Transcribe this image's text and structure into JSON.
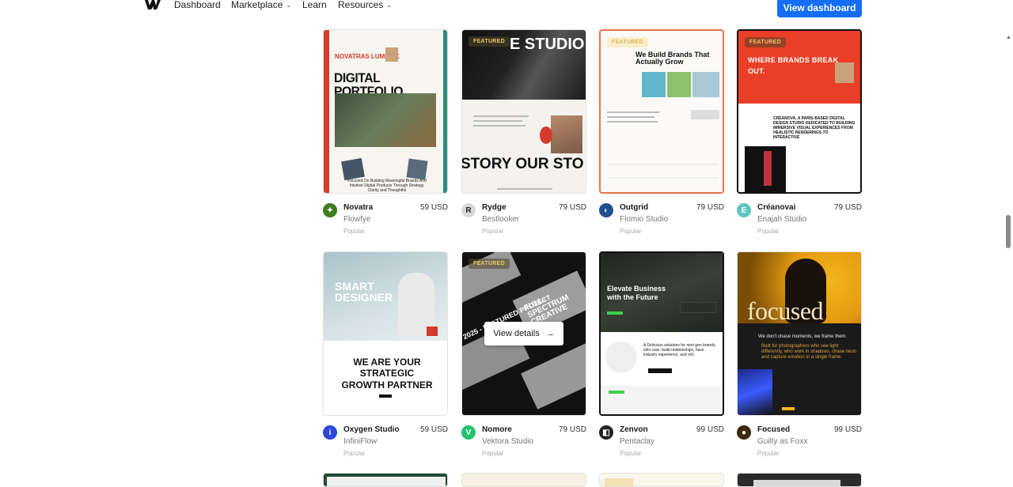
{
  "nav": {
    "items": [
      {
        "label": "Dashboard",
        "has_menu": false
      },
      {
        "label": "Marketplace",
        "has_menu": true
      },
      {
        "label": "Learn",
        "has_menu": false
      },
      {
        "label": "Resources",
        "has_menu": true
      }
    ],
    "cta": "View dashboard"
  },
  "cards": [
    {
      "title": "Novatra",
      "seller": "Flowfye",
      "price": "59 USD",
      "tag": "Popular",
      "featured": "",
      "avatar_color": "#3a7d1e",
      "thumb_text": "DIGITAL PORTFOLIO",
      "thumb_sub": "NOVATRAS LUMIVEX",
      "thumb_caption": "Focused On Building Meaningful Brands And Intuitive Digital Products Through Strategy, Clarity and Thoughtful"
    },
    {
      "title": "Rydge",
      "seller": "Bestlooker",
      "price": "79 USD",
      "tag": "Popular",
      "featured": "FEATURED",
      "avatar_color": "#d9d9d9",
      "thumb_text": "E STUDIO",
      "thumb_sub": "STORY  OUR STO"
    },
    {
      "title": "Outgrid",
      "seller": "Flomio Studio",
      "price": "79 USD",
      "tag": "Popular",
      "featured": "FEATURED",
      "avatar_color": "#1f4f8f",
      "thumb_text": "We Build Brands That Actually Grow"
    },
    {
      "title": "Créanovai",
      "seller": "Enajah Studio",
      "price": "79 USD",
      "tag": "Popular",
      "featured": "FEATURED",
      "avatar_color": "#5ec6c0",
      "thumb_text": "WHERE BRANDS BREAK OUT.",
      "thumb_sub": "CRÉANOVA, A PARIS-BASED DIGITAL DESIGN STUDIO DEDICATED TO BUILDING IMMERSIVE VISUAL EXPERIENCES FROM HEALISTIC RENDERINGS TO INTERACTIVE"
    },
    {
      "title": "Oxygen Studio",
      "seller": "InfiniFlow",
      "price": "59 USD",
      "tag": "Popular",
      "featured": "",
      "avatar_color": "#2e46d6",
      "thumb_text": "SMART DESIGNER",
      "thumb_sub": "WE ARE YOUR STRATEGIC GROWTH PARTNER"
    },
    {
      "title": "Nomore",
      "seller": "Vektora Studio",
      "price": "79 USD",
      "tag": "Popular",
      "featured": "FEATURED",
      "avatar_color": "#25c270",
      "thumb_text": "FULL-SPECTRUM CREATIVE",
      "thumb_sub": "2025 - FEATURED PROJECT",
      "hover_button": "View details"
    },
    {
      "title": "Zenvon",
      "seller": "Pentaclay",
      "price": "99 USD",
      "tag": "Popular",
      "featured": "",
      "avatar_color": "#222222",
      "thumb_text": "Elevate Business with the Future",
      "thumb_sub": "A Delicious solutions for next gen brands, who care, build relationships, have industry experience, and rich"
    },
    {
      "title": "Focused",
      "seller": "Guilty as Foxx",
      "price": "99 USD",
      "tag": "Popular",
      "featured": "",
      "avatar_color": "#3a2a10",
      "thumb_text": "focused",
      "thumb_sub": "We don't chase moments, we frame them.",
      "thumb_caption": "Built for photographers who see light differently, who work in shadows, chase neon and capture emotion in a single frame."
    }
  ],
  "icons": {
    "logo": "webflow-logo-icon",
    "chevron": "chevron-down-icon",
    "arrow": "arrow-right-icon"
  },
  "colors": {
    "accent": "#146ef5"
  }
}
